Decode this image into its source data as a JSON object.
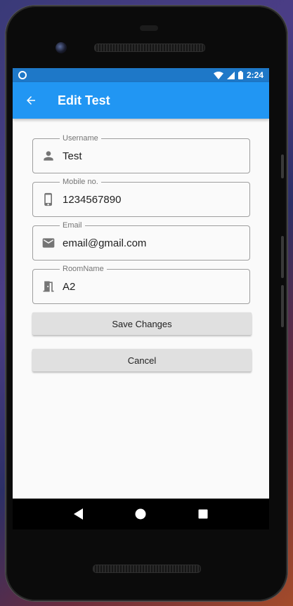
{
  "status_bar": {
    "time": "2:24"
  },
  "app_bar": {
    "title": "Edit Test"
  },
  "fields": [
    {
      "label": "Username",
      "value": "Test",
      "icon": "person-icon"
    },
    {
      "label": "Mobile no.",
      "value": "1234567890",
      "icon": "phone-icon"
    },
    {
      "label": "Email",
      "value": "email@gmail.com",
      "icon": "email-icon"
    },
    {
      "label": "RoomName",
      "value": "A2",
      "icon": "door-icon"
    }
  ],
  "buttons": {
    "save_label": "Save Changes",
    "cancel_label": "Cancel"
  },
  "colors": {
    "primary": "#2196f3",
    "status_bar": "#1e78c8",
    "background": "#fafafa",
    "button": "#e0e0e0"
  }
}
